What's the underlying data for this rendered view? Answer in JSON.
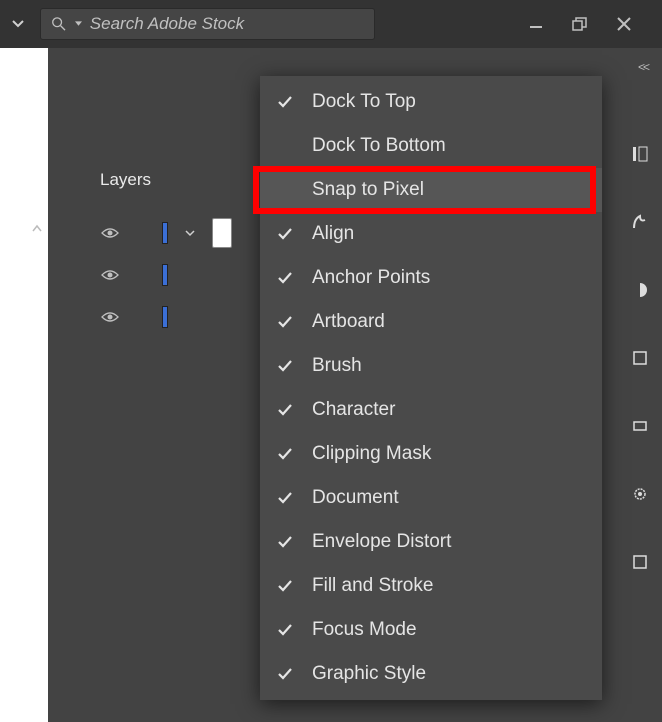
{
  "search": {
    "placeholder": "Search Adobe Stock"
  },
  "layers": {
    "title": "Layers"
  },
  "menu": {
    "items": [
      {
        "label": "Dock To Top",
        "checked": true,
        "highlighted": false
      },
      {
        "label": "Dock To Bottom",
        "checked": false,
        "highlighted": false
      },
      {
        "label": "Snap to Pixel",
        "checked": false,
        "highlighted": true
      },
      {
        "label": "Align",
        "checked": true,
        "highlighted": false
      },
      {
        "label": "Anchor Points",
        "checked": true,
        "highlighted": false
      },
      {
        "label": "Artboard",
        "checked": true,
        "highlighted": false
      },
      {
        "label": "Brush",
        "checked": true,
        "highlighted": false
      },
      {
        "label": "Character",
        "checked": true,
        "highlighted": false
      },
      {
        "label": "Clipping Mask",
        "checked": true,
        "highlighted": false
      },
      {
        "label": "Document",
        "checked": true,
        "highlighted": false
      },
      {
        "label": "Envelope Distort",
        "checked": true,
        "highlighted": false
      },
      {
        "label": "Fill and Stroke",
        "checked": true,
        "highlighted": false
      },
      {
        "label": "Focus Mode",
        "checked": true,
        "highlighted": false
      },
      {
        "label": "Graphic Style",
        "checked": true,
        "highlighted": false
      }
    ]
  }
}
